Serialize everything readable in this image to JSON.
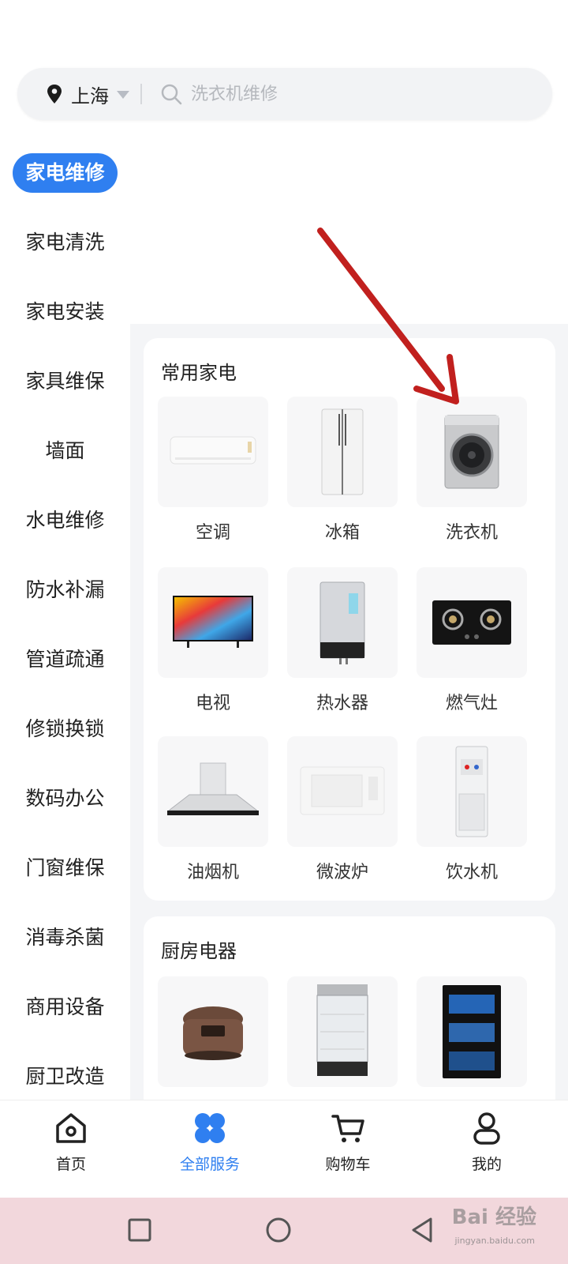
{
  "search": {
    "city": "上海",
    "placeholder": "洗衣机维修"
  },
  "sidebar": {
    "items": [
      {
        "label": "家电维修",
        "active": true
      },
      {
        "label": "家电清洗"
      },
      {
        "label": "家电安装"
      },
      {
        "label": "家具维保"
      },
      {
        "label": "墙面"
      },
      {
        "label": "水电维修"
      },
      {
        "label": "防水补漏"
      },
      {
        "label": "管道疏通"
      },
      {
        "label": "修锁换锁"
      },
      {
        "label": "数码办公"
      },
      {
        "label": "门窗维保"
      },
      {
        "label": "消毒杀菌"
      },
      {
        "label": "商用设备"
      },
      {
        "label": "厨卫改造"
      }
    ]
  },
  "sections": [
    {
      "title": "常用家电",
      "items": [
        {
          "label": "空调",
          "icon": "air-conditioner-icon"
        },
        {
          "label": "冰箱",
          "icon": "fridge-icon"
        },
        {
          "label": "洗衣机",
          "icon": "washing-machine-icon"
        },
        {
          "label": "电视",
          "icon": "tv-icon"
        },
        {
          "label": "热水器",
          "icon": "water-heater-icon"
        },
        {
          "label": "燃气灶",
          "icon": "gas-stove-icon"
        },
        {
          "label": "油烟机",
          "icon": "range-hood-icon"
        },
        {
          "label": "微波炉",
          "icon": "microwave-icon"
        },
        {
          "label": "饮水机",
          "icon": "water-dispenser-icon"
        }
      ]
    },
    {
      "title": "厨房电器",
      "items": [
        {
          "icon": "rice-cooker-icon"
        },
        {
          "icon": "steamer-cabinet-icon"
        },
        {
          "icon": "disinfection-cabinet-icon"
        }
      ]
    }
  ],
  "tabbar": {
    "items": [
      {
        "label": "首页",
        "icon": "home-icon"
      },
      {
        "label": "全部服务",
        "icon": "all-services-icon",
        "active": true
      },
      {
        "label": "购物车",
        "icon": "cart-icon"
      },
      {
        "label": "我的",
        "icon": "profile-icon"
      }
    ]
  },
  "watermark": {
    "brand": "Bai 经验",
    "url": "jingyan.baidu.com"
  },
  "colors": {
    "accent": "#2f7ff0",
    "arrow": "#c1201e",
    "navbar": "#f2d7dc"
  }
}
